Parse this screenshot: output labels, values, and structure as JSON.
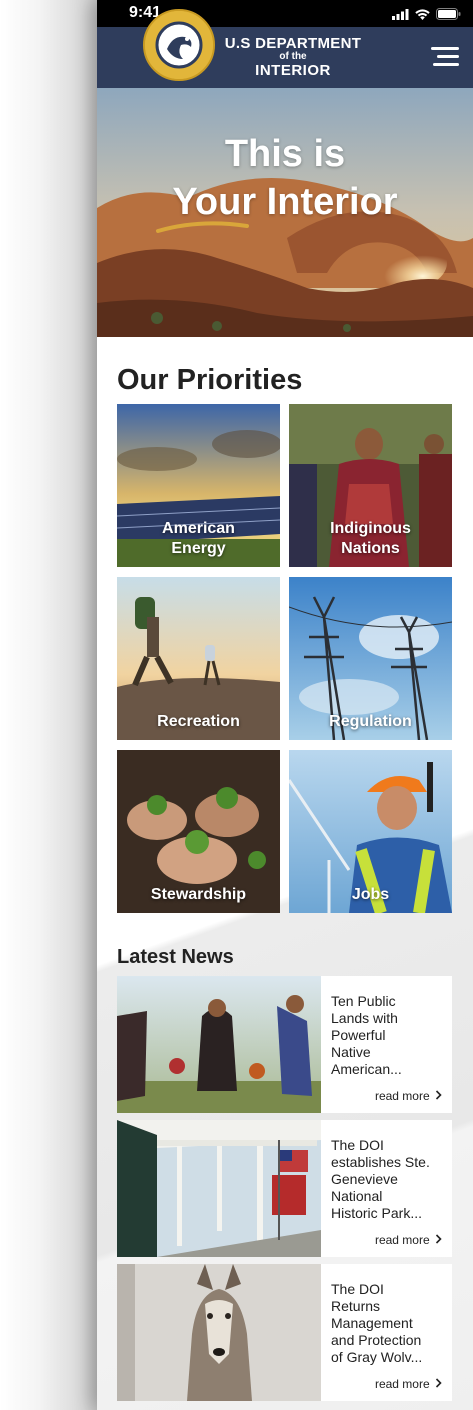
{
  "status_bar": {
    "time": "9:41"
  },
  "header": {
    "line1": "U.S DEPARTMENT",
    "line2": "of the",
    "line3": "INTERIOR",
    "seal": {
      "top_text": "U.S. DEPARTMENT",
      "bottom_text": "OF THE INTERIOR"
    }
  },
  "hero": {
    "title_line1": "This is",
    "title_line2": "Your Interior"
  },
  "priorities": {
    "title": "Our Priorities",
    "tiles": [
      {
        "label_line1": "American",
        "label_line2": "Energy"
      },
      {
        "label_line1": "Indiginous",
        "label_line2": "Nations"
      },
      {
        "label_line1": "Recreation",
        "label_line2": ""
      },
      {
        "label_line1": "Regulation",
        "label_line2": ""
      },
      {
        "label_line1": "Stewardship",
        "label_line2": ""
      },
      {
        "label_line1": "Jobs",
        "label_line2": ""
      }
    ]
  },
  "news": {
    "title": "Latest News",
    "items": [
      {
        "lines": [
          "Ten Public",
          "Lands with",
          "Powerful",
          "Native",
          "American..."
        ],
        "read_more": "read more"
      },
      {
        "lines": [
          "The DOI",
          "establishes Ste.",
          "Genevieve",
          "National",
          "Historic Park..."
        ],
        "read_more": "read more"
      },
      {
        "lines": [
          "The DOI",
          "Returns",
          "Management",
          "and Protection",
          "of Gray Wolv..."
        ],
        "read_more": "read more"
      }
    ]
  },
  "colors": {
    "header_bg": "#2f3d5c",
    "seal_gold": "#e2b63a",
    "accent_underline": "#d9a63a"
  },
  "icons": [
    "signal-icon",
    "wifi-icon",
    "battery-icon",
    "menu-icon",
    "chevron-right-icon"
  ]
}
